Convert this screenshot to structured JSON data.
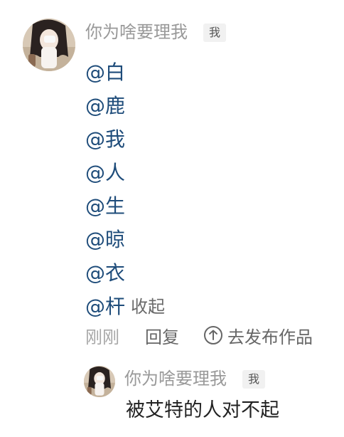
{
  "comment": {
    "username": "你为啥要理我",
    "badge": "我",
    "mentions": [
      "@白",
      "@鹿",
      "@我",
      "@人",
      "@生",
      "@晾",
      "@衣",
      "@杆"
    ],
    "collapse_label": "收起",
    "time": "刚刚",
    "reply_label": "回复",
    "publish_label": "去发布作品",
    "publish_icon": "arrow-up-circle-icon"
  },
  "reply": {
    "username": "你为啥要理我",
    "badge": "我",
    "text": "被艾特的人对不起"
  },
  "colors": {
    "mention": "#1e4c7a",
    "username": "#999999",
    "secondary": "#666666"
  }
}
